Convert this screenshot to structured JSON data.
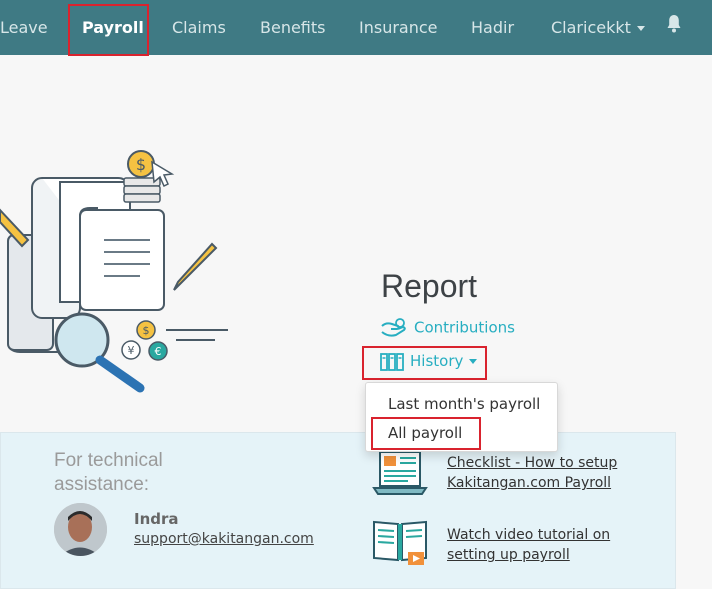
{
  "nav": {
    "items": [
      {
        "label": "Leave"
      },
      {
        "label": "Payroll"
      },
      {
        "label": "Claims"
      },
      {
        "label": "Benefits"
      },
      {
        "label": "Insurance"
      },
      {
        "label": "Hadir"
      },
      {
        "label": "Claricekkt"
      }
    ],
    "bell_icon": "bell-icon"
  },
  "report": {
    "title": "Report",
    "contributions_label": "Contributions",
    "history_label": "History"
  },
  "history_menu": {
    "items": [
      {
        "label": "Last month's payroll"
      },
      {
        "label": "All payroll"
      }
    ]
  },
  "help": {
    "heading": "For technical assistance:",
    "contact_name": "Indra",
    "contact_email": "support@kakitangan.com",
    "resources": [
      {
        "label": "Checklist - How to setup Kakitangan.com Payroll"
      },
      {
        "label": "Watch video tutorial on setting up payroll"
      }
    ]
  },
  "colors": {
    "navbar": "#3f7a84",
    "accent": "#27aec1",
    "highlight": "#d9232e",
    "help_panel": "#e5f3f8"
  }
}
